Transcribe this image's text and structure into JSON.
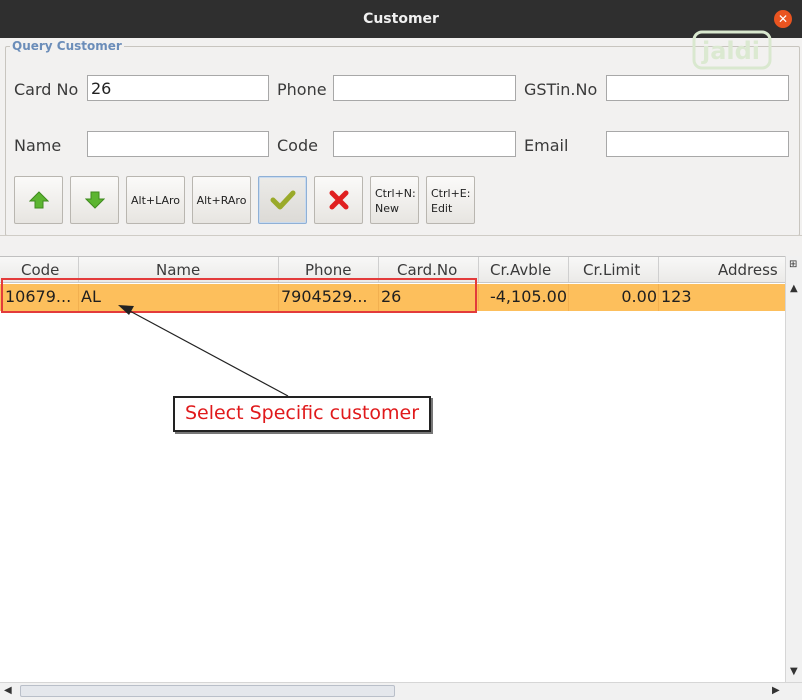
{
  "window": {
    "title": "Customer"
  },
  "query": {
    "group_title": "Query Customer",
    "labels": {
      "card_no": "Card No",
      "phone": "Phone",
      "gstin": "GSTin.No",
      "name": "Name",
      "code": "Code",
      "email": "Email"
    },
    "values": {
      "card_no": "26",
      "phone": "",
      "gstin": "",
      "name": "",
      "code": "",
      "email": ""
    }
  },
  "toolbar": {
    "alt_left": "Alt+LAro",
    "alt_right": "Alt+RAro",
    "ctrl_n": "Ctrl+N:\nNew",
    "ctrl_e": "Ctrl+E:\nEdit"
  },
  "table": {
    "columns": [
      "Code",
      "Name",
      "Phone",
      "Card.No",
      "Cr.Avble",
      "Cr.Limit",
      "Address"
    ],
    "rows": [
      {
        "code": "10679...",
        "name": "AL",
        "phone": "7904529...",
        "card_no": "26",
        "cr_avble": "-4,105.00",
        "cr_limit": "0.00",
        "address": "123"
      }
    ]
  },
  "annotation": {
    "text": "Select Specific customer"
  },
  "colors": {
    "selected_row": "#fdbf5c",
    "highlight": "#e33b3b",
    "close": "#e95420",
    "group_title": "#6b8db9"
  },
  "icons": [
    "close-icon",
    "up-arrow-icon",
    "down-arrow-icon",
    "checkmark-icon",
    "x-icon",
    "column-menu-icon"
  ]
}
